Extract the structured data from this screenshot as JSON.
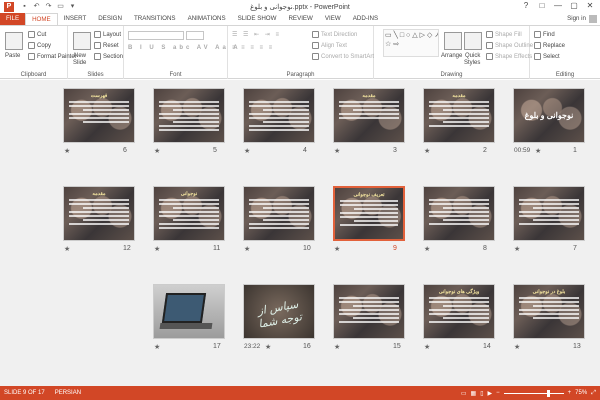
{
  "window": {
    "title": "نوجوانی و بلوغ.pptx - PowerPoint",
    "app_icon": "P",
    "qat": [
      "save-icon",
      "undo-icon",
      "redo-icon",
      "present-icon",
      "dropdown-icon"
    ],
    "controls": [
      "?",
      "□",
      "—",
      "▢",
      "✕"
    ],
    "sign_in": "Sign in"
  },
  "tabs": [
    {
      "label": "FILE",
      "state": "file"
    },
    {
      "label": "HOME",
      "state": "active"
    },
    {
      "label": "INSERT"
    },
    {
      "label": "DESIGN"
    },
    {
      "label": "TRANSITIONS"
    },
    {
      "label": "ANIMATIONS"
    },
    {
      "label": "SLIDE SHOW"
    },
    {
      "label": "REVIEW"
    },
    {
      "label": "VIEW"
    },
    {
      "label": "ADD-INS"
    }
  ],
  "ribbon": {
    "clipboard": {
      "label": "Clipboard",
      "paste": "Paste",
      "cut": "Cut",
      "copy": "Copy",
      "format_painter": "Format Painter"
    },
    "slides": {
      "label": "Slides",
      "new_slide": "New",
      "new_slide2": "Slide",
      "layout": "Layout",
      "reset": "Reset",
      "section": "Section"
    },
    "font": {
      "label": "Font"
    },
    "paragraph": {
      "label": "Paragraph",
      "text_direction": "Text Direction",
      "align_text": "Align Text",
      "convert_smartart": "Convert to SmartArt"
    },
    "drawing": {
      "label": "Drawing",
      "arrange": "Arrange",
      "quick_styles": "Quick",
      "quick_styles2": "Styles",
      "shape_fill": "Shape Fill",
      "shape_outline": "Shape Outline",
      "shape_effects": "Shape Effects",
      "shapes_glyphs": "▭╲□○△▷◇↗↘⌒{}☆⇨"
    },
    "editing": {
      "label": "Editing",
      "find": "Find",
      "replace": "Replace",
      "select": "Select"
    }
  },
  "slides": [
    {
      "num": "1",
      "title": "",
      "big": "نوجوانی و بلوغ",
      "lines": 0,
      "timing": "00:59",
      "kind": "photo"
    },
    {
      "num": "2",
      "title": "مقدمه",
      "lines": 7,
      "kind": "photo"
    },
    {
      "num": "3",
      "title": "مقدمه",
      "lines": 5,
      "kind": "photo"
    },
    {
      "num": "4",
      "title": "",
      "lines": 8,
      "kind": "photo"
    },
    {
      "num": "5",
      "title": "",
      "lines": 8,
      "kind": "photo"
    },
    {
      "num": "6",
      "title": "فهرست",
      "lines": 6,
      "kind": "photo"
    },
    {
      "num": "7",
      "title": "",
      "lines": 7,
      "kind": "photo"
    },
    {
      "num": "8",
      "title": "",
      "lines": 7,
      "kind": "photo"
    },
    {
      "num": "9",
      "title": "تعریف نوجوانی",
      "lines": 7,
      "kind": "photo",
      "selected": true
    },
    {
      "num": "10",
      "title": "",
      "lines": 8,
      "kind": "photo"
    },
    {
      "num": "11",
      "title": "نوجوانی",
      "lines": 8,
      "kind": "photo"
    },
    {
      "num": "12",
      "title": "مقدمه",
      "lines": 7,
      "kind": "photo"
    },
    {
      "num": "13",
      "title": "بلوغ در نوجوانی",
      "lines": 6,
      "kind": "photo"
    },
    {
      "num": "14",
      "title": "ویژگی های نوجوانی",
      "lines": 7,
      "kind": "photo"
    },
    {
      "num": "15",
      "title": "",
      "lines": 7,
      "kind": "photo"
    },
    {
      "num": "16",
      "title": "",
      "lines": 0,
      "timing": "23:22",
      "kind": "callig",
      "callig": "سپاس از توجه شما"
    },
    {
      "num": "17",
      "title": "",
      "lines": 0,
      "kind": "laptop"
    }
  ],
  "status": {
    "slide": "SLIDE 9 OF 17",
    "language": "PERSIAN",
    "zoom": "75%",
    "zoom_fraction": 0.75
  }
}
